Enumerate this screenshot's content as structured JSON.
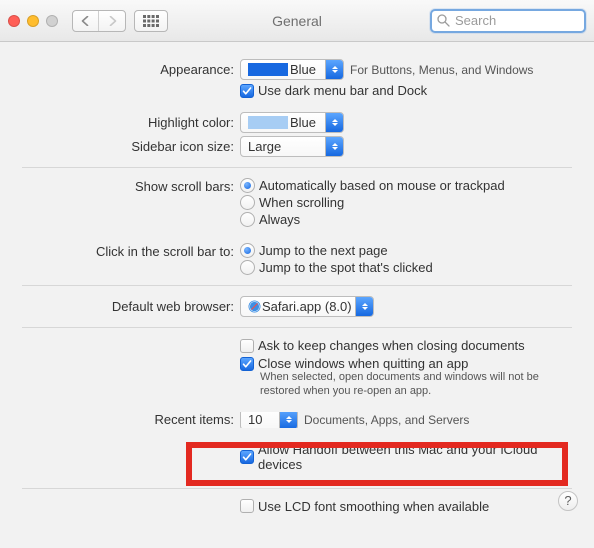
{
  "window": {
    "title": "General"
  },
  "search": {
    "placeholder": "Search"
  },
  "labels": {
    "appearance": "Appearance:",
    "highlight_color": "Highlight color:",
    "sidebar_icon": "Sidebar icon size:",
    "scroll_bars": "Show scroll bars:",
    "click_scroll": "Click in the scroll bar to:",
    "default_browser": "Default web browser:",
    "recent_items": "Recent items:"
  },
  "appearance": {
    "value": "Blue",
    "hint": "For Buttons, Menus, and Windows",
    "dark_menu_label": "Use dark menu bar and Dock",
    "dark_menu_checked": true
  },
  "highlight": {
    "value": "Blue"
  },
  "sidebar": {
    "value": "Large"
  },
  "scrollbars": {
    "auto": "Automatically based on mouse or trackpad",
    "when": "When scrolling",
    "always": "Always",
    "selected": "auto"
  },
  "clickscroll": {
    "next": "Jump to the next page",
    "spot": "Jump to the spot that's clicked",
    "selected": "next"
  },
  "browser": {
    "value": "Safari.app (8.0)"
  },
  "closing": {
    "ask_label": "Ask to keep changes when closing documents",
    "ask_checked": false,
    "close_label": "Close windows when quitting an app",
    "close_checked": true,
    "close_hint": "When selected, open documents and windows will not be restored when you re-open an app."
  },
  "recent": {
    "value": "10",
    "suffix": "Documents, Apps, and Servers"
  },
  "handoff": {
    "label": "Allow Handoff between this Mac and your iCloud devices",
    "checked": true
  },
  "lcd": {
    "label": "Use LCD font smoothing when available",
    "checked": false
  },
  "help_tooltip": "?"
}
